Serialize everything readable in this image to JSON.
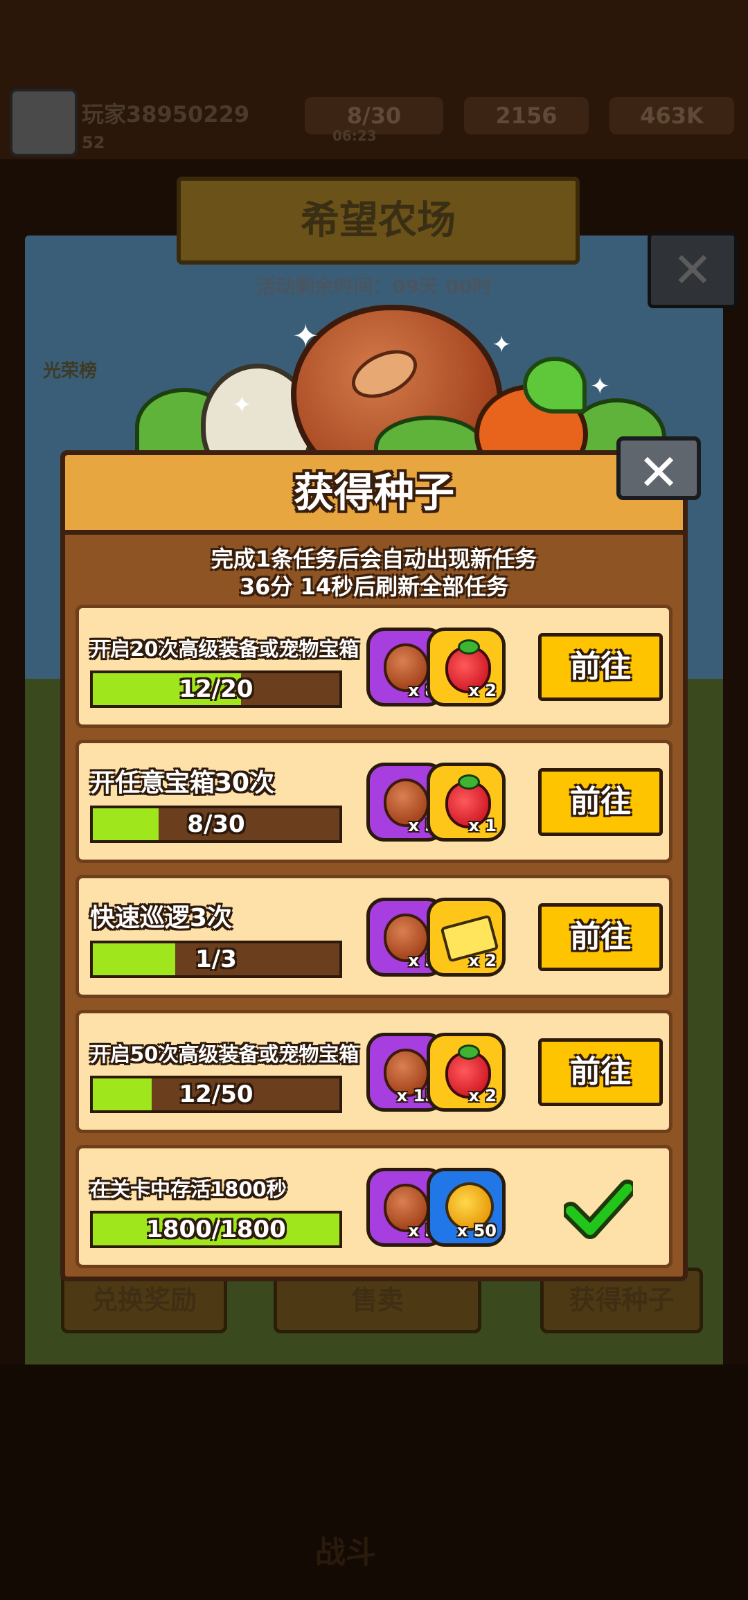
{
  "background": {
    "player_name": "玩家38950229",
    "player_level": "52",
    "energy": "8/30",
    "energy_timer": "06:23",
    "gems": "2156",
    "coins": "463K",
    "banner_title": "希望农场",
    "timer_text": "活动剩余时间：09天 00时",
    "honor_label": "光荣榜",
    "bottom_buttons": [
      "兑换奖励",
      "售卖",
      "获得种子"
    ],
    "fight_label": "战斗"
  },
  "dialog": {
    "title": "获得种子",
    "close_symbol": "✕",
    "info_line1": "完成1条任务后会自动出现新任务",
    "info_line2": "36分 14秒后刷新全部任务",
    "go_label": "前往"
  },
  "tasks": [
    {
      "title": "开启20次高级装备或宠物宝箱",
      "progress_text": "12/20",
      "progress": 0.6,
      "rewards": [
        {
          "icon": "bean-icon",
          "count": "x 8"
        },
        {
          "icon": "strawberry-icon",
          "count": "x 2"
        }
      ],
      "completed": false
    },
    {
      "title": "开任意宝箱30次",
      "progress_text": "8/30",
      "progress": 0.267,
      "rewards": [
        {
          "icon": "bean-icon",
          "count": "x 5"
        },
        {
          "icon": "strawberry-icon",
          "count": "x 1"
        }
      ],
      "completed": false
    },
    {
      "title": "快速巡逻3次",
      "progress_text": "1/3",
      "progress": 0.333,
      "rewards": [
        {
          "icon": "bean-icon",
          "count": "x 5"
        },
        {
          "icon": "ticket-icon",
          "count": "x 2"
        }
      ],
      "completed": false
    },
    {
      "title": "开启50次高级装备或宠物宝箱",
      "progress_text": "12/50",
      "progress": 0.24,
      "rewards": [
        {
          "icon": "bean-icon",
          "count": "x 15"
        },
        {
          "icon": "strawberry-icon",
          "count": "x 2"
        }
      ],
      "completed": false
    },
    {
      "title": "在关卡中存活1800秒",
      "progress_text": "1800/1800",
      "progress": 1.0,
      "rewards": [
        {
          "icon": "bean-icon",
          "count": "x 5"
        },
        {
          "icon": "coin-icon",
          "count": "x 50"
        }
      ],
      "completed": true
    }
  ],
  "colors": {
    "progress_fill": "#9fe61c",
    "go_button": "#ffc400",
    "panel": "#fde1a8",
    "check": "#22c61a"
  }
}
